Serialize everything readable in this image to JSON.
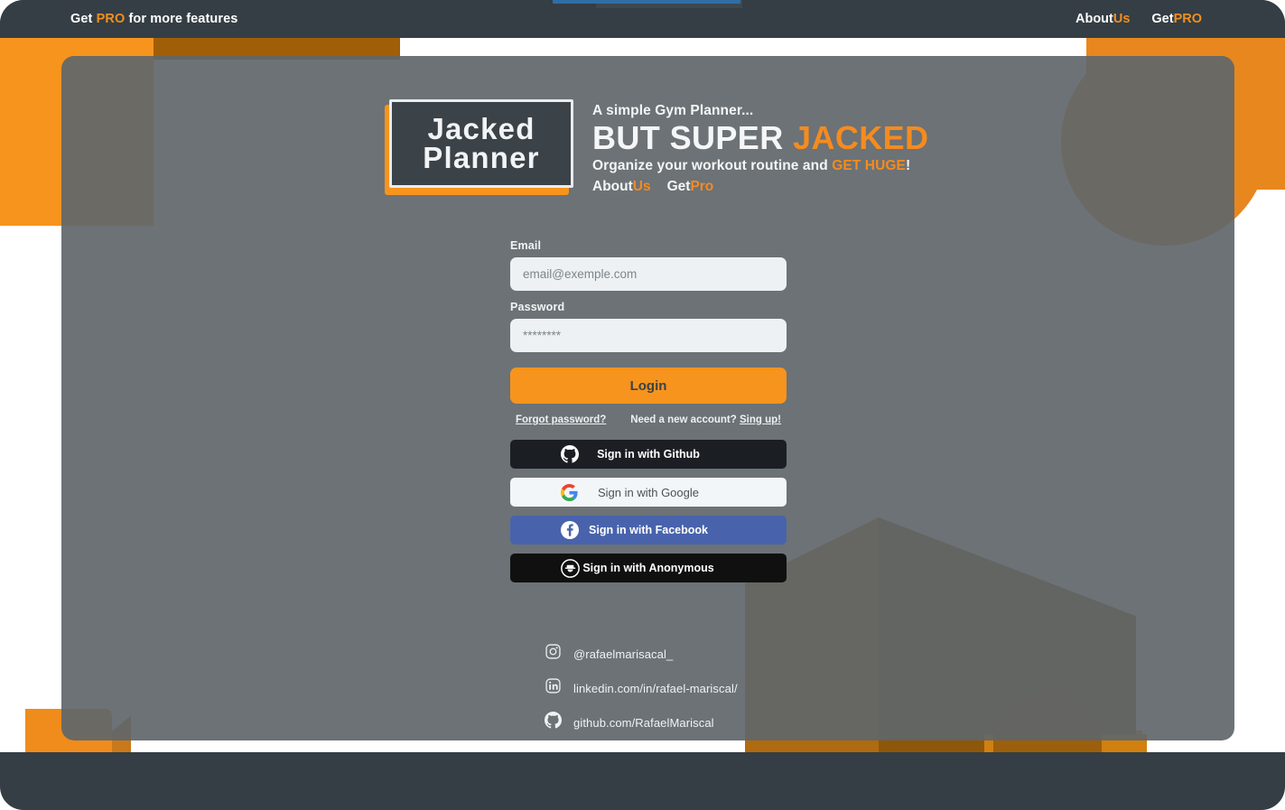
{
  "topbar": {
    "left_prefix": "Get ",
    "left_accent": "PRO",
    "left_suffix": " for more features",
    "nav": [
      {
        "name": "about-us",
        "white": "About",
        "accent": "Us"
      },
      {
        "name": "get-pro",
        "white": "Get",
        "accent": "PRO"
      }
    ]
  },
  "logo": {
    "line1": "Jacked",
    "line2": "Planner"
  },
  "tagline": {
    "small": "A simple Gym Planner...",
    "big_white": "BUT SUPER ",
    "big_accent": "JACKED",
    "mid_white": "Organize your workout routine and ",
    "mid_accent": "GET HUGE",
    "mid_tail": "!",
    "links": [
      {
        "white": "About",
        "accent": "Us"
      },
      {
        "white": "Get",
        "accent": "Pro"
      }
    ]
  },
  "form": {
    "email_label": "Email",
    "email_placeholder": "email@exemple.com",
    "email_value": "",
    "password_label": "Password",
    "password_placeholder": "********",
    "password_value": "",
    "login_label": "Login",
    "forgot_label": "Forgot password?",
    "need_account_label": "Need a new account?",
    "signup_label": "Sing up!"
  },
  "social_buttons": [
    {
      "icon": "github-icon",
      "label": "Sign in with Github"
    },
    {
      "icon": "google-icon",
      "label": "Sign in with Google"
    },
    {
      "icon": "facebook-icon",
      "label": "Sign in with Facebook"
    },
    {
      "icon": "anonymous-icon",
      "label": "Sign in with Anonymous"
    }
  ],
  "footer_links": [
    {
      "icon": "instagram-icon",
      "label": "@rafaelmarisacal_"
    },
    {
      "icon": "linkedin-icon",
      "label": "linkedin.com/in/rafael-mariscal/"
    },
    {
      "icon": "github-icon",
      "label": "github.com/RafaelMariscal"
    }
  ],
  "colors": {
    "orange": "#f7941d",
    "dark": "#343e44",
    "panel": "#5f666a",
    "facebook_blue": "#4863ac",
    "github_dark": "#1b1f23"
  }
}
